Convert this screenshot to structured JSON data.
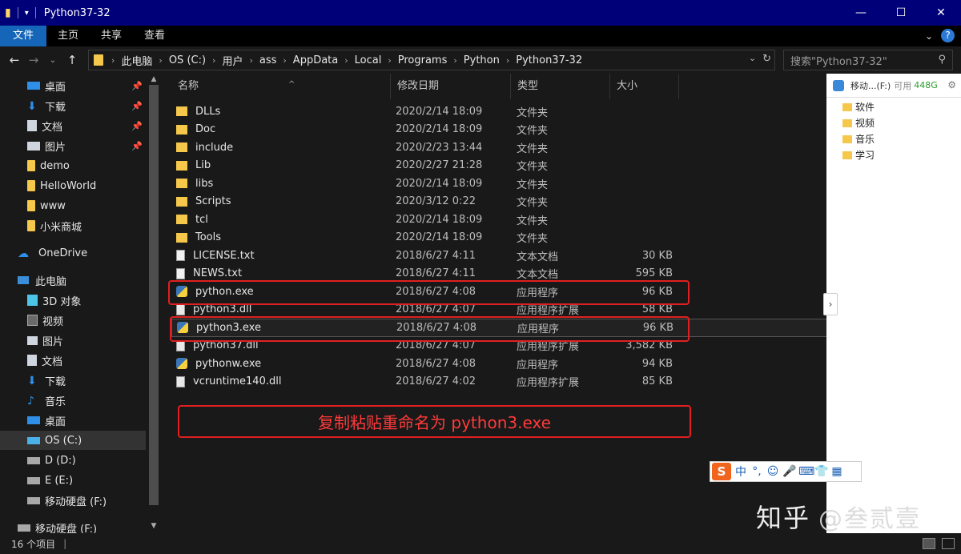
{
  "window": {
    "title": "Python37-32",
    "controls": [
      "—",
      "☐",
      "✕"
    ]
  },
  "ribbon": {
    "tabs": [
      "文件",
      "主页",
      "共享",
      "查看"
    ]
  },
  "address": {
    "crumbs": [
      "此电脑",
      "OS (C:)",
      "用户",
      "ass",
      "AppData",
      "Local",
      "Programs",
      "Python",
      "Python37-32"
    ],
    "search_placeholder": "搜索\"Python37-32\""
  },
  "sidebar": {
    "items": [
      {
        "label": "桌面",
        "icon": "desktop-icon",
        "pinned": true
      },
      {
        "label": "下载",
        "icon": "download-icon",
        "pinned": true
      },
      {
        "label": "文档",
        "icon": "document-icon",
        "pinned": true
      },
      {
        "label": "图片",
        "icon": "picture-icon",
        "pinned": true
      },
      {
        "label": "demo",
        "icon": "folder-icon"
      },
      {
        "label": "HelloWorld",
        "icon": "folder-icon"
      },
      {
        "label": "www",
        "icon": "folder-icon"
      },
      {
        "label": "小米商城",
        "icon": "folder-icon"
      },
      {
        "label": "OneDrive",
        "icon": "cloud-icon"
      },
      {
        "label": "此电脑",
        "icon": "computer-icon"
      },
      {
        "label": "3D 对象",
        "icon": "3d-objects-icon"
      },
      {
        "label": "视频",
        "icon": "video-icon"
      },
      {
        "label": "图片",
        "icon": "picture-icon"
      },
      {
        "label": "文档",
        "icon": "document-icon"
      },
      {
        "label": "下载",
        "icon": "download-icon"
      },
      {
        "label": "音乐",
        "icon": "music-icon"
      },
      {
        "label": "桌面",
        "icon": "desktop-icon"
      },
      {
        "label": "OS (C:)",
        "icon": "drive-icon",
        "selected": true
      },
      {
        "label": "D (D:)",
        "icon": "drive-icon"
      },
      {
        "label": "E (E:)",
        "icon": "drive-icon"
      },
      {
        "label": "移动硬盘 (F:)",
        "icon": "drive-icon"
      },
      {
        "label": "移动硬盘 (F:)",
        "icon": "drive-icon"
      }
    ]
  },
  "filelist": {
    "columns": [
      "名称",
      "修改日期",
      "类型",
      "大小"
    ],
    "rows": [
      {
        "name": "DLLs",
        "date": "2020/2/14 18:09",
        "type": "文件夹",
        "size": "",
        "kind": "folder"
      },
      {
        "name": "Doc",
        "date": "2020/2/14 18:09",
        "type": "文件夹",
        "size": "",
        "kind": "folder"
      },
      {
        "name": "include",
        "date": "2020/2/23 13:44",
        "type": "文件夹",
        "size": "",
        "kind": "folder"
      },
      {
        "name": "Lib",
        "date": "2020/2/27 21:28",
        "type": "文件夹",
        "size": "",
        "kind": "folder"
      },
      {
        "name": "libs",
        "date": "2020/2/14 18:09",
        "type": "文件夹",
        "size": "",
        "kind": "folder"
      },
      {
        "name": "Scripts",
        "date": "2020/3/12 0:22",
        "type": "文件夹",
        "size": "",
        "kind": "folder"
      },
      {
        "name": "tcl",
        "date": "2020/2/14 18:09",
        "type": "文件夹",
        "size": "",
        "kind": "folder"
      },
      {
        "name": "Tools",
        "date": "2020/2/14 18:09",
        "type": "文件夹",
        "size": "",
        "kind": "folder"
      },
      {
        "name": "LICENSE.txt",
        "date": "2018/6/27 4:11",
        "type": "文本文档",
        "size": "30 KB",
        "kind": "text"
      },
      {
        "name": "NEWS.txt",
        "date": "2018/6/27 4:11",
        "type": "文本文档",
        "size": "595 KB",
        "kind": "text"
      },
      {
        "name": "python.exe",
        "date": "2018/6/27 4:08",
        "type": "应用程序",
        "size": "96 KB",
        "kind": "exe"
      },
      {
        "name": "python3.dll",
        "date": "2018/6/27 4:07",
        "type": "应用程序扩展",
        "size": "58 KB",
        "kind": "dll"
      },
      {
        "name": "python3.exe",
        "date": "2018/6/27 4:08",
        "type": "应用程序",
        "size": "96 KB",
        "kind": "exe",
        "highlighted": true
      },
      {
        "name": "python37.dll",
        "date": "2018/6/27 4:07",
        "type": "应用程序扩展",
        "size": "3,582 KB",
        "kind": "dll"
      },
      {
        "name": "pythonw.exe",
        "date": "2018/6/27 4:08",
        "type": "应用程序",
        "size": "94 KB",
        "kind": "exe"
      },
      {
        "name": "vcruntime140.dll",
        "date": "2018/6/27 4:02",
        "type": "应用程序扩展",
        "size": "85 KB",
        "kind": "dll"
      }
    ]
  },
  "annotation": {
    "text": "复制粘贴重命名为 python3.exe",
    "color": "#e02020"
  },
  "right_pane": {
    "drive_label": "移动...(F:)",
    "free_label": "可用",
    "free_value": "448G",
    "folders": [
      "软件",
      "视频",
      "音乐",
      "学习"
    ]
  },
  "ime": {
    "logo": "S",
    "items": [
      "中",
      "°,",
      "☺",
      "🎤",
      "⌨",
      "👕",
      "▦"
    ]
  },
  "watermark": {
    "brand": "知乎",
    "handle": "@叁贰壹"
  },
  "statusbar": {
    "count": "16 个项目",
    "sep": "|"
  },
  "colors": {
    "titlebar": "#000078",
    "file_tab": "#1566b8",
    "background": "#191919",
    "annotation_red": "#e02020"
  }
}
